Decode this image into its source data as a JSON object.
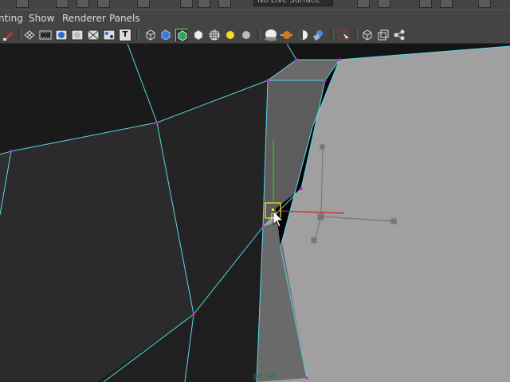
{
  "menubar": {
    "items": [
      {
        "id": "menu-painting",
        "label": "nting"
      },
      {
        "id": "menu-show",
        "label": "Show"
      },
      {
        "id": "menu-renderer",
        "label": "Renderer"
      },
      {
        "id": "menu-panels",
        "label": "Panels"
      }
    ]
  },
  "toolbar": {
    "image_plane_label": "T"
  },
  "top_field": {
    "value": "No Live Surface"
  },
  "viewport": {
    "camera_label": "persp",
    "background_color": "#a0a0a0",
    "wire_color": "#56d8e8",
    "vertex_color": "#d020d0",
    "axis_colors": {
      "x": "#d02020",
      "y": "#20d020"
    }
  }
}
